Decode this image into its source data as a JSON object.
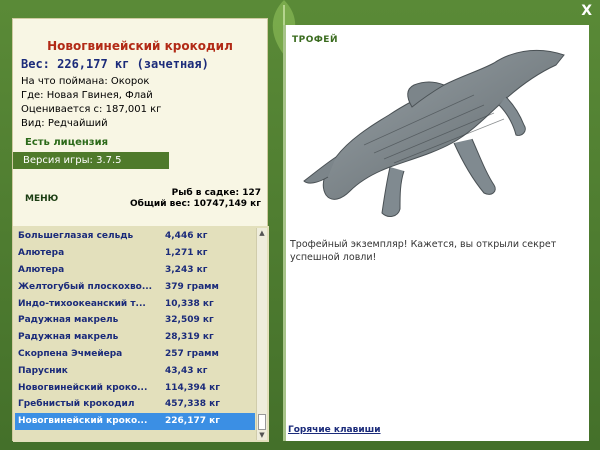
{
  "window": {
    "close_label": "X"
  },
  "catch": {
    "title": "Новогвинейский крокодил",
    "weight": "Вес: 226,177 кг (зачетная)",
    "bait": "На что поймана: Окорок",
    "location": "Где: Новая Гвинея, Флай",
    "valued": "Оценивается с: 187,001 кг",
    "rarity": "Вид: Редчайший"
  },
  "license": "Есть лицензия",
  "version": "Версия игры: 3.7.5",
  "menu_label": "МЕНЮ",
  "stats": {
    "fish_in_cage": "Рыб в садке: 127",
    "total_weight": "Общий вес: 10747,149 кг"
  },
  "fish_list": [
    {
      "name": "Большеглазая сельдь",
      "weight": "4,446 кг"
    },
    {
      "name": "Алютера",
      "weight": "1,271 кг"
    },
    {
      "name": "Алютера",
      "weight": "3,243 кг"
    },
    {
      "name": "Желтогубый плоскохво...",
      "weight": "379 грамм"
    },
    {
      "name": "Индо-тихоокеанский т...",
      "weight": "10,338 кг"
    },
    {
      "name": "Радужная макрель",
      "weight": "32,509 кг"
    },
    {
      "name": "Радужная макрель",
      "weight": "28,319 кг"
    },
    {
      "name": "Скорпена Эчмейера",
      "weight": "257 грамм"
    },
    {
      "name": "Парусник",
      "weight": "43,43 кг"
    },
    {
      "name": "Новогвинейский кроко...",
      "weight": "114,394 кг"
    },
    {
      "name": "Гребнистый крокодил",
      "weight": "457,338 кг"
    },
    {
      "name": "Новогвинейский кроко...",
      "weight": "226,177 кг"
    }
  ],
  "selected_index": 11,
  "trophy_label": "ТРОФЕЙ",
  "description": "Трофейный экземпляр! Кажется, вы открыли секрет успешной ловли!",
  "hotkeys_label": "Горячие клавиши",
  "colors": {
    "frame": "#4d7a2e",
    "title_red": "#b22a16",
    "text_blue": "#1b2b7a",
    "selection": "#3b8fe4"
  }
}
